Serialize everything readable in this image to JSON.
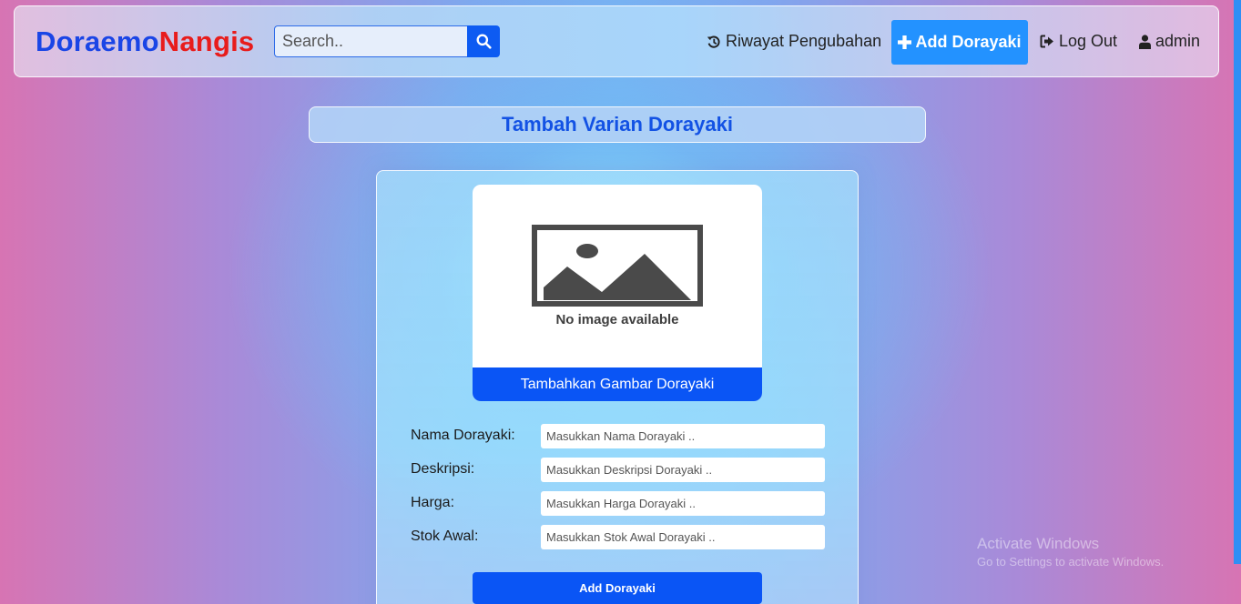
{
  "brand": {
    "part1": "Doraemo",
    "part2": "Nangis"
  },
  "search": {
    "placeholder": "Search..",
    "icon": "search-icon"
  },
  "nav": {
    "history": {
      "label": "Riwayat Pengubahan",
      "icon": "history-icon"
    },
    "add": {
      "label": "Add Dorayaki",
      "icon": "plus-icon"
    },
    "logout": {
      "label": "Log Out",
      "icon": "sign-out-icon"
    },
    "user": {
      "label": "admin",
      "icon": "user-icon"
    }
  },
  "page": {
    "title": "Tambah Varian Dorayaki"
  },
  "image": {
    "caption": "No image available",
    "upload_label": "Tambahkan Gambar Dorayaki"
  },
  "form": {
    "fields": [
      {
        "label": "Nama Dorayaki:",
        "placeholder": "Masukkan Nama Dorayaki .."
      },
      {
        "label": "Deskripsi:",
        "placeholder": "Masukkan Deskripsi Dorayaki .."
      },
      {
        "label": "Harga:",
        "placeholder": "Masukkan Harga Dorayaki .."
      },
      {
        "label": "Stok Awal:",
        "placeholder": "Masukkan Stok Awal Dorayaki .."
      }
    ],
    "submit_label": "Add Dorayaki"
  },
  "watermark": {
    "title": "Activate Windows",
    "subtitle": "Go to Settings to activate Windows."
  },
  "colors": {
    "brand_blue": "#1a45e6",
    "brand_red": "#e81c1c",
    "primary": "#0a55f5",
    "nav_accent": "#2392ff"
  }
}
